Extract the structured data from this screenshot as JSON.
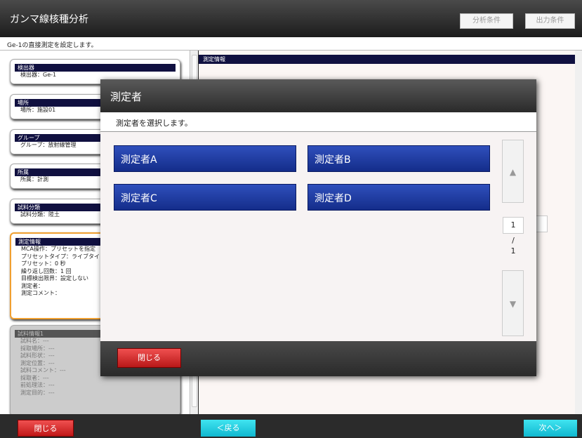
{
  "app": {
    "title": "ガンマ線核種分析",
    "header_buttons": {
      "analysis": "分析条件",
      "output": "出力条件"
    },
    "instruction": "Ge-1の直接測定を設定します。"
  },
  "left_cards": [
    {
      "head": "検出器",
      "lines": [
        "検出器：Ge-1"
      ]
    },
    {
      "head": "場所",
      "lines": [
        "場所：施設01"
      ]
    },
    {
      "head": "グループ",
      "lines": [
        "グループ：放射線管理"
      ]
    },
    {
      "head": "所属",
      "lines": [
        "所属：計測"
      ]
    },
    {
      "head": "試料分類",
      "lines": [
        "試料分類：陸土"
      ]
    },
    {
      "head": "測定情報",
      "lines": [
        "MCA操作：プリセットを指定",
        "プリセットタイプ：ライブタイ",
        "プリセット：0 秒",
        "繰り返し回数：1 回",
        "目標検出限界：設定しない",
        "測定者：",
        "測定コメント："
      ]
    },
    {
      "head": "試料情報1",
      "lines": [
        "試料名：---",
        "採取場所：---",
        "試料形状：---",
        "測定位置：---",
        "試料コメント：---",
        "採取者：---",
        "前処理法：---",
        "測定目的：---"
      ]
    }
  ],
  "right_panel": {
    "head": "測定情報"
  },
  "footer": {
    "close": "閉じる",
    "back": "＜戻る",
    "next": "次へ＞"
  },
  "dialog": {
    "title": "測定者",
    "subtitle": "測定者を選択します。",
    "persons": [
      "測定者A",
      "測定者B",
      "測定者C",
      "測定者D"
    ],
    "pager": {
      "up": "▲",
      "down": "▼",
      "current_page": "1",
      "separator": "/",
      "total_pages": "1"
    },
    "close": "閉じる"
  }
}
